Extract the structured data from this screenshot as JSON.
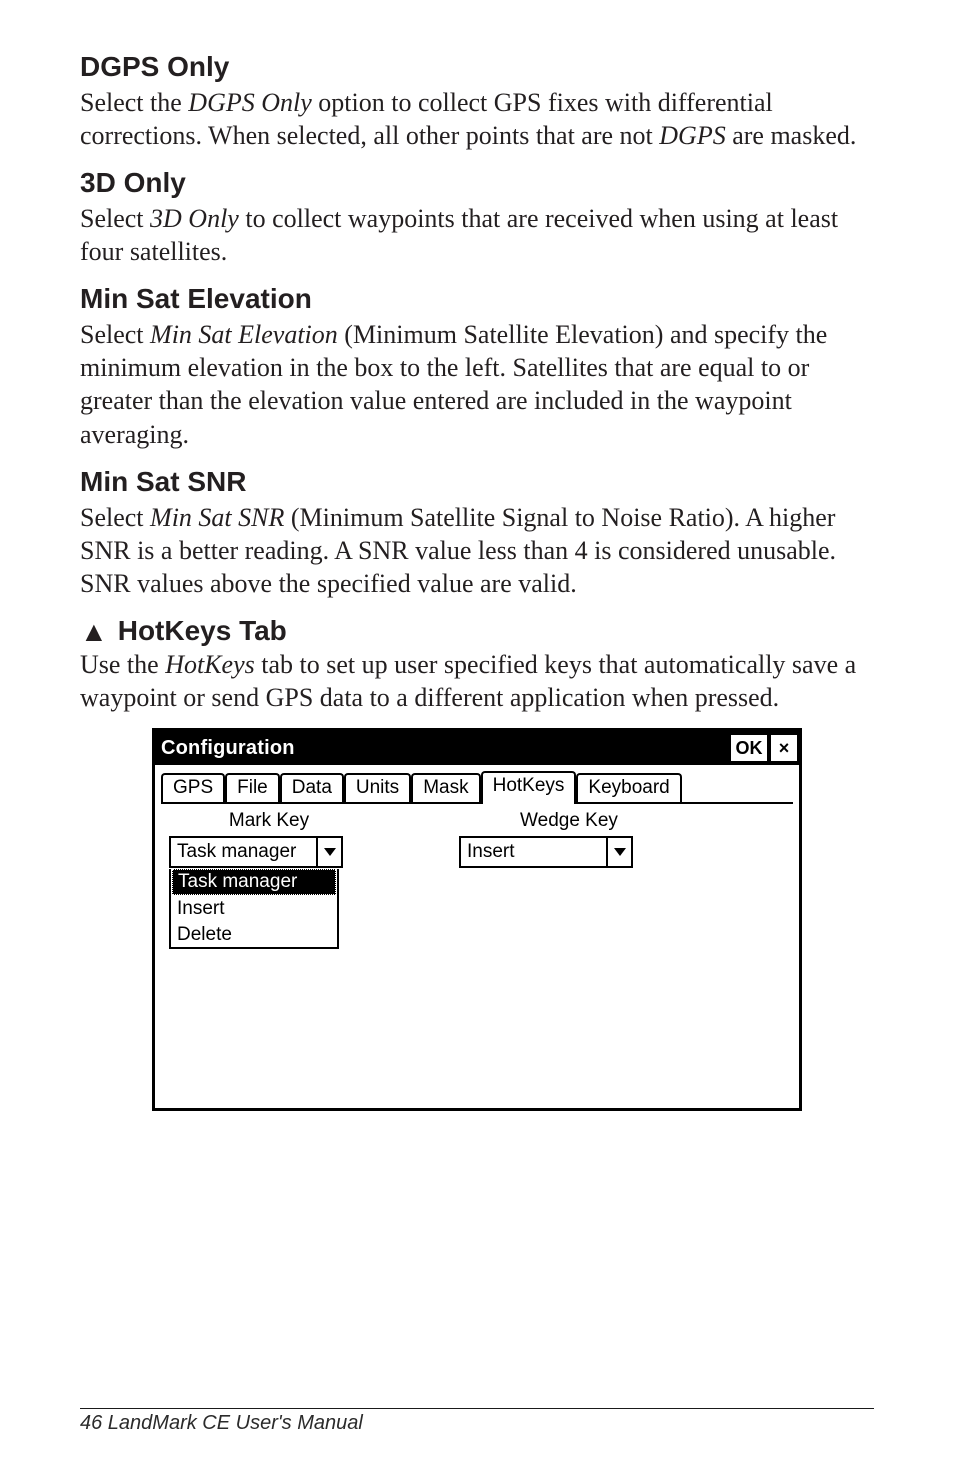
{
  "sections": {
    "dgps": {
      "heading": "DGPS Only",
      "body_parts": [
        "Select the ",
        "DGPS Only",
        " option to collect GPS fixes with differential corrections. When selected, all other points that are not ",
        "DGPS",
        " are masked."
      ]
    },
    "threeD": {
      "heading": "3D Only",
      "body_parts": [
        "Select ",
        "3D Only",
        " to collect waypoints that are received when using at least four satellites."
      ]
    },
    "minSatElev": {
      "heading": "Min Sat Elevation",
      "body_parts": [
        "Select ",
        "Min Sat Elevation",
        " (Minimum Satellite Elevation) and specify the minimum elevation in the box to the left. Satellites that are equal to or greater than the elevation value entered are included in the waypoint averaging."
      ]
    },
    "minSatSNR": {
      "heading": "Min Sat SNR",
      "body_parts": [
        "Select ",
        "Min Sat SNR",
        " (Minimum Satellite Signal to Noise Ratio). A higher SNR is a better reading. A SNR value less than 4 is considered unusable. SNR values above the specified value are valid."
      ]
    },
    "hotkeys": {
      "arrow": "▲",
      "heading": "HotKeys Tab",
      "body_parts": [
        "Use the ",
        "HotKeys",
        " tab to set up user specified keys that automatically save a waypoint or send GPS data to a different application when pressed."
      ]
    }
  },
  "screenshot": {
    "title": "Configuration",
    "ok": "OK",
    "close": "×",
    "tabs": {
      "gps": "GPS",
      "file": "File",
      "data": "Data",
      "units": "Units",
      "mask": "Mask",
      "hotkeys": "HotKeys",
      "keyboard": "Keyboard"
    },
    "markKey": {
      "label": "Mark Key",
      "selected": "Task manager",
      "options": [
        "Task manager",
        "Insert",
        "Delete"
      ]
    },
    "wedgeKey": {
      "label": "Wedge Key",
      "selected": "Insert"
    }
  },
  "footer": "46  LandMark CE User's Manual"
}
